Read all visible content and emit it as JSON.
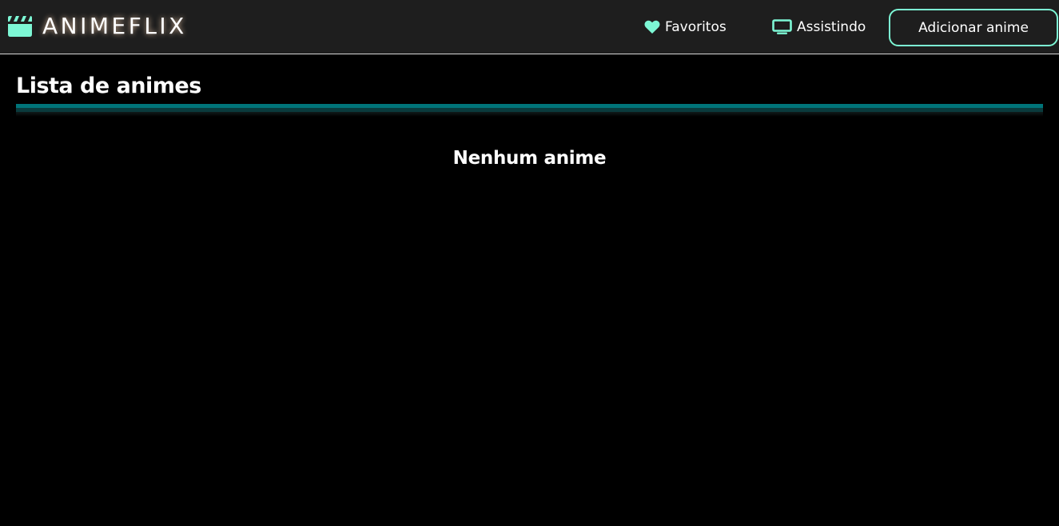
{
  "app": {
    "title": "ANIMEFLIX",
    "logo_icon": "clapperboard-icon",
    "accent_color": "#7df7d5"
  },
  "nav": {
    "favorites": {
      "label": "Favoritos",
      "icon": "heart-icon"
    },
    "watching": {
      "label": "Assistindo",
      "icon": "tv-icon"
    },
    "add_button": "Adicionar anime"
  },
  "main": {
    "title": "Lista de animes",
    "empty_message": "Nenhum anime"
  }
}
